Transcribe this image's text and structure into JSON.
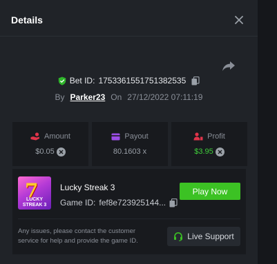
{
  "modal": {
    "title": "Details"
  },
  "bet": {
    "id_prefix": "Bet ID:",
    "id": "1753361551751382535",
    "by_label": "By",
    "username": "Parker23",
    "on_label": "On",
    "date": "27/12/2022 07:11:19"
  },
  "stats": {
    "amount": {
      "label": "Amount",
      "value": "$0.05"
    },
    "payout": {
      "label": "Payout",
      "value": "80.1603 x"
    },
    "profit": {
      "label": "Profit",
      "value": "$3.95"
    }
  },
  "game": {
    "name": "Lucky Streak 3",
    "id_label": "Game ID:",
    "id": "fef8e723925144...",
    "thumb_label": "LUCKY STREAK 3",
    "play_label": "Play Now"
  },
  "support": {
    "text": "Any issues, please contact the customer service for help and provide the game ID.",
    "button_label": "Live Support"
  },
  "colors": {
    "accent_green": "#3cc224",
    "profit_green": "#3fcf3b",
    "amount_red": "#e0344a",
    "payout_purple": "#9b4de6"
  },
  "icons": [
    "close-icon",
    "share-icon",
    "shield-check-icon",
    "copy-icon",
    "hand-coins-icon",
    "wallet-icon",
    "user-profit-icon",
    "clear-icon",
    "headset-icon"
  ]
}
